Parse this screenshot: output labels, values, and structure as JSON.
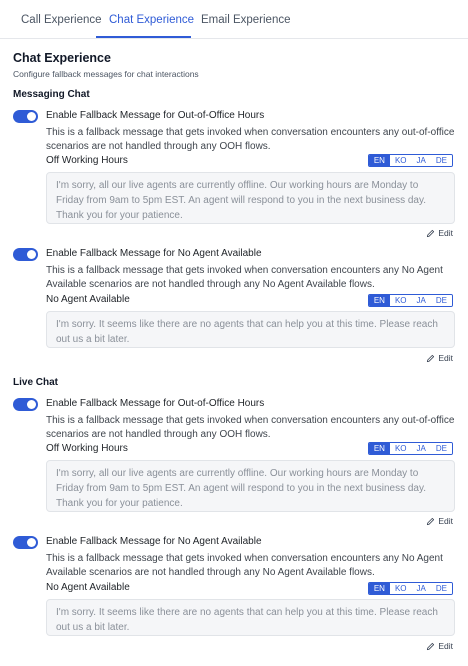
{
  "tabs": [
    {
      "label": "Call Experience",
      "active": false
    },
    {
      "label": "Chat Experience",
      "active": true
    },
    {
      "label": "Email Experience",
      "active": false
    }
  ],
  "page": {
    "title": "Chat Experience",
    "subtitle": "Configure fallback messages for chat interactions"
  },
  "languages": [
    "EN",
    "KO",
    "JA",
    "DE"
  ],
  "selected_language": "EN",
  "edit_label": "Edit",
  "accent_color": "#2f5bd6",
  "sections": [
    {
      "title": "Messaging Chat",
      "blocks": [
        {
          "enabled": true,
          "title": "Enable Fallback Message for Out-of-Office Hours",
          "description": "This is a fallback message that gets invoked when conversation encounters any out-of-office scenarios are not handled through any OOH flows.",
          "field_label": "Off Working Hours",
          "message": "I'm sorry, all our live agents are currently offline. Our working hours are Monday to Friday from 9am to 5pm EST. An agent will respond to you in the next business day. Thank you for your patience."
        },
        {
          "enabled": true,
          "title": "Enable Fallback Message for No Agent Available",
          "description": "This is a fallback message that gets invoked when conversation encounters any No Agent Available scenarios are not handled through any No Agent Available flows.",
          "field_label": "No Agent Available",
          "message": "I'm sorry. It seems like there are no agents that can help you at this time. Please reach out us a bit later."
        }
      ]
    },
    {
      "title": "Live Chat",
      "blocks": [
        {
          "enabled": true,
          "title": "Enable Fallback Message for Out-of-Office Hours",
          "description": "This is a fallback message that gets invoked when conversation encounters any out-of-office scenarios are not handled through any OOH flows.",
          "field_label": "Off Working Hours",
          "message": "I'm sorry, all our live agents are currently offline. Our working hours are Monday to Friday from 9am to 5pm EST. An agent will respond to you in the next business day. Thank you for your patience."
        },
        {
          "enabled": true,
          "title": "Enable Fallback Message for No Agent Available",
          "description": "This is a fallback message that gets invoked when conversation encounters any No Agent Available scenarios are not handled through any No Agent Available flows.",
          "field_label": "No Agent Available",
          "message": "I'm sorry. It seems like there are no agents that can help you at this time. Please reach out us a bit later."
        }
      ]
    }
  ]
}
